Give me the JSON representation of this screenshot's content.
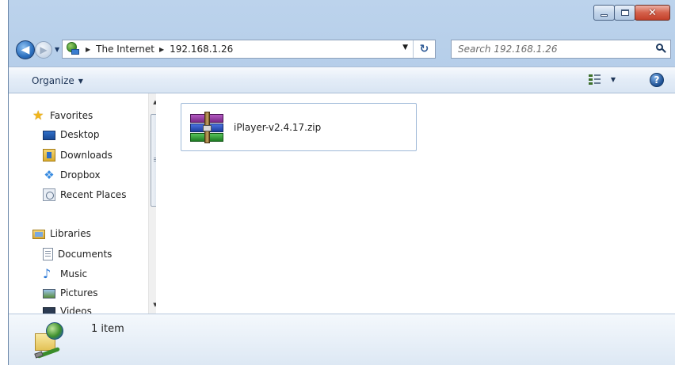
{
  "window": {
    "caption_buttons": {
      "minimize_icon": "minimize-icon",
      "maximize_icon": "maximize-icon",
      "close_glyph": "✕"
    }
  },
  "nav": {
    "back_glyph": "◀",
    "forward_glyph": "▶",
    "breadcrumb": [
      "The Internet",
      "192.168.1.26"
    ],
    "search_placeholder": "Search 192.168.1.26",
    "refresh_glyph": "↻"
  },
  "toolbar": {
    "organize_label": "Organize",
    "help_glyph": "?"
  },
  "sidebar": {
    "favorites": {
      "label": "Favorites",
      "items": [
        {
          "label": "Desktop",
          "icon": "desktop-icon"
        },
        {
          "label": "Downloads",
          "icon": "downloads-icon"
        },
        {
          "label": "Dropbox",
          "icon": "dropbox-icon"
        },
        {
          "label": "Recent Places",
          "icon": "recent-places-icon"
        }
      ]
    },
    "libraries": {
      "label": "Libraries",
      "items": [
        {
          "label": "Documents",
          "icon": "documents-icon"
        },
        {
          "label": "Music",
          "icon": "music-icon"
        },
        {
          "label": "Pictures",
          "icon": "pictures-icon"
        },
        {
          "label": "Videos",
          "icon": "videos-icon"
        }
      ]
    }
  },
  "files": [
    {
      "name": "iPlayer-v2.4.17.zip",
      "icon": "zip-archive-icon"
    }
  ],
  "details": {
    "item_count": "1 item"
  },
  "colors": {
    "accent": "#2b6fbe",
    "close_button": "#c3402a",
    "selection_border": "#9fb9d8"
  }
}
